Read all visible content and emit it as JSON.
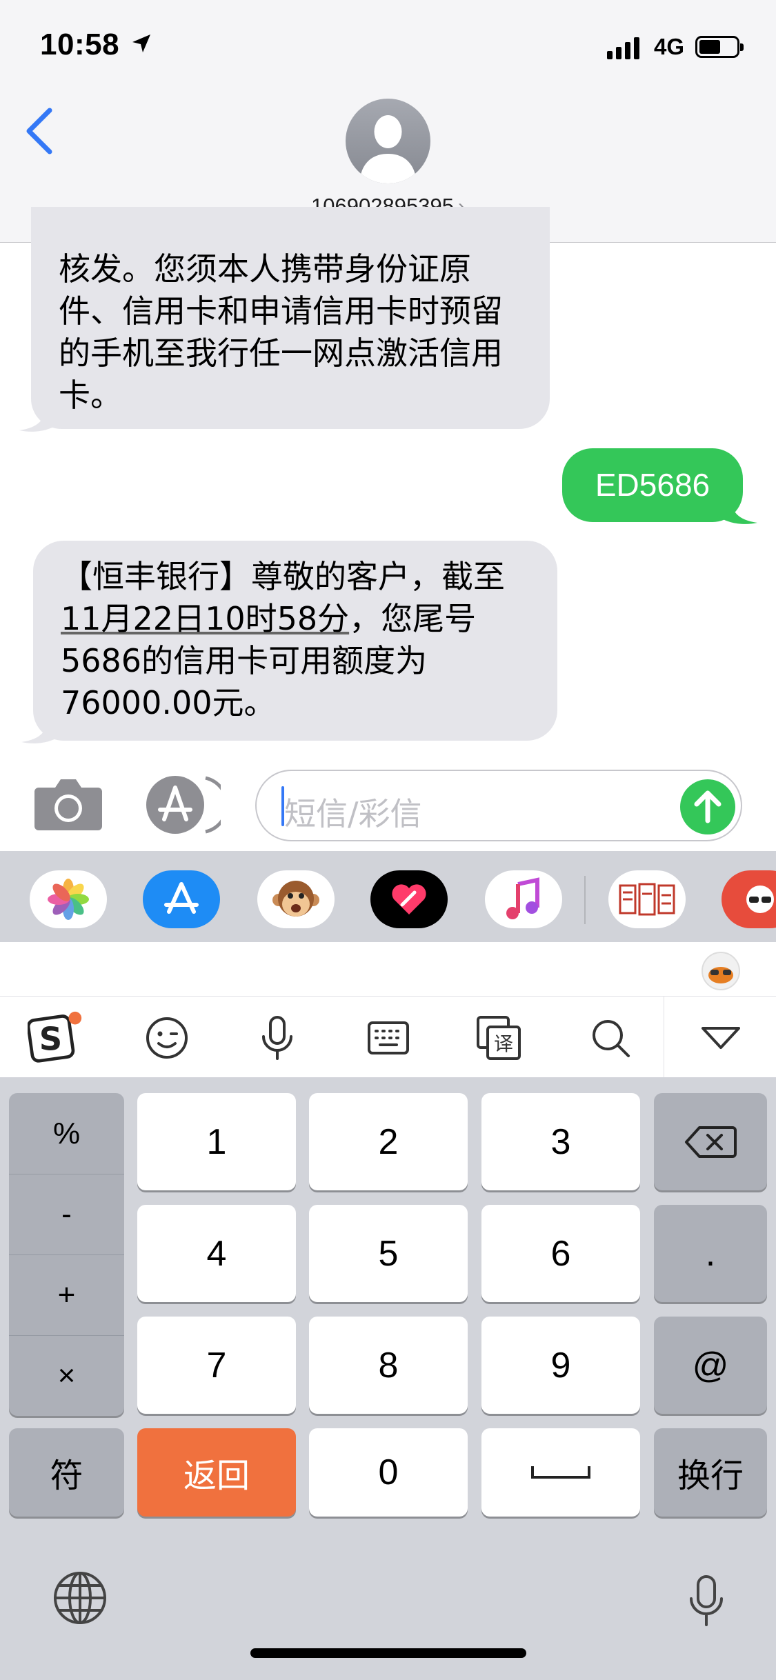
{
  "status_bar": {
    "time": "10:58",
    "network": "4G"
  },
  "header": {
    "contact": "106902895395",
    "chevron": "›"
  },
  "messages": [
    {
      "direction": "incoming",
      "text": "核发。您须本人携带身份证原件、信用卡和申请信用卡时预留的手机至我行任一网点激活信用卡。"
    },
    {
      "direction": "outgoing",
      "text": "ED5686"
    },
    {
      "direction": "incoming",
      "text_prefix": "【恒丰银行】尊敬的客户，截至",
      "link": "11月22日10时58分",
      "text_suffix": "，您尾号5686的信用卡可用额度为76000.00元。"
    }
  ],
  "input": {
    "placeholder": "短信/彩信"
  },
  "app_tray": [
    "photos-icon",
    "app-store-icon",
    "animoji-icon",
    "digital-touch-icon",
    "music-icon",
    "sticker-app-icon",
    "sogou-sticker-icon"
  ],
  "ime_toolbar": [
    "sogou-logo-icon",
    "emoji-icon",
    "microphone-icon",
    "keyboard-icon",
    "translate-icon",
    "search-icon",
    "collapse-icon"
  ],
  "keyboard": {
    "symbols": [
      "%",
      "-",
      "+",
      "×"
    ],
    "digits": [
      "1",
      "2",
      "3",
      "4",
      "5",
      "6",
      "7",
      "8",
      "9",
      "0"
    ],
    "dot": ".",
    "at": "@",
    "fu": "符",
    "back": "返回",
    "enter": "换行"
  },
  "colors": {
    "incoming_bubble": "#e5e5ea",
    "outgoing_bubble": "#34c759",
    "accent": "#3478f6",
    "return_key": "#f0713e"
  }
}
